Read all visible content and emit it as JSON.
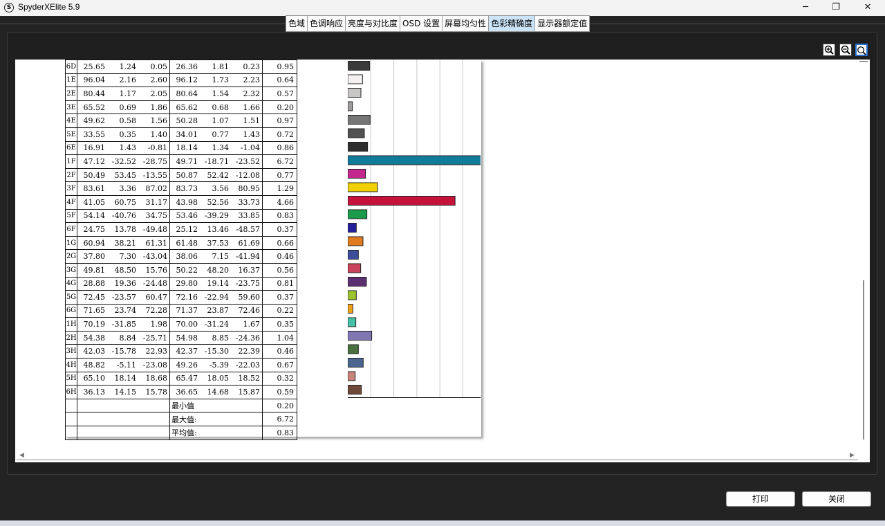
{
  "window": {
    "title": "SpyderXElite 5.9",
    "app_icon_glyph": "S",
    "controls": {
      "minimize": "─",
      "maximize": "❐",
      "close": "✕"
    }
  },
  "tabs": [
    {
      "label": "色域",
      "active": false
    },
    {
      "label": "色调响应",
      "active": false
    },
    {
      "label": "亮度与对比度",
      "active": false
    },
    {
      "label": "OSD 设置",
      "active": false
    },
    {
      "label": "屏幕均匀性",
      "active": false
    },
    {
      "label": "色彩精确度",
      "active": true
    },
    {
      "label": "显示器额定值",
      "active": false
    }
  ],
  "toolbar": {
    "icons": [
      "zoom-in-icon",
      "zoom-out-icon",
      "zoom-fit-icon"
    ]
  },
  "rows": [
    {
      "id": "6D",
      "ref": [
        "25.65",
        "1.24",
        "0.05"
      ],
      "meas": [
        "26.36",
        "1.81",
        "0.23"
      ],
      "de": "0.95",
      "color": "#3a3a3a"
    },
    {
      "id": "1E",
      "ref": [
        "96.04",
        "2.16",
        "2.60"
      ],
      "meas": [
        "96.12",
        "1.73",
        "2.23"
      ],
      "de": "0.64",
      "color": "#f4f0f0"
    },
    {
      "id": "2E",
      "ref": [
        "80.44",
        "1.17",
        "2.05"
      ],
      "meas": [
        "80.64",
        "1.54",
        "2.32"
      ],
      "de": "0.57",
      "color": "#c9c6c6"
    },
    {
      "id": "3E",
      "ref": [
        "65.52",
        "0.69",
        "1.86"
      ],
      "meas": [
        "65.62",
        "0.68",
        "1.66"
      ],
      "de": "0.20",
      "color": "#9e9c9c"
    },
    {
      "id": "4E",
      "ref": [
        "49.62",
        "0.58",
        "1.56"
      ],
      "meas": [
        "50.28",
        "1.07",
        "1.51"
      ],
      "de": "0.97",
      "color": "#767676"
    },
    {
      "id": "5E",
      "ref": [
        "33.55",
        "0.35",
        "1.40"
      ],
      "meas": [
        "34.01",
        "0.77",
        "1.43"
      ],
      "de": "0.72",
      "color": "#515151"
    },
    {
      "id": "6E",
      "ref": [
        "16.91",
        "1.43",
        "-0.81"
      ],
      "meas": [
        "18.14",
        "1.34",
        "-1.04"
      ],
      "de": "0.86",
      "color": "#2e2e2e"
    },
    {
      "id": "1F",
      "ref": [
        "47.12",
        "-32.52",
        "-28.75"
      ],
      "meas": [
        "49.71",
        "-18.71",
        "-23.52"
      ],
      "de": "6.72",
      "color": "#0f7d9a"
    },
    {
      "id": "2F",
      "ref": [
        "50.49",
        "53.45",
        "-13.55"
      ],
      "meas": [
        "50.87",
        "52.42",
        "-12.08"
      ],
      "de": "0.77",
      "color": "#c3278e"
    },
    {
      "id": "3F",
      "ref": [
        "83.61",
        "3.36",
        "87.02"
      ],
      "meas": [
        "83.73",
        "3.56",
        "80.95"
      ],
      "de": "1.29",
      "color": "#f1d000"
    },
    {
      "id": "4F",
      "ref": [
        "41.05",
        "60.75",
        "31.17"
      ],
      "meas": [
        "43.98",
        "52.56",
        "33.73"
      ],
      "de": "4.66",
      "color": "#c4123a"
    },
    {
      "id": "5F",
      "ref": [
        "54.14",
        "-40.76",
        "34.75"
      ],
      "meas": [
        "53.46",
        "-39.29",
        "33.85"
      ],
      "de": "0.83",
      "color": "#1a9a4a"
    },
    {
      "id": "6F",
      "ref": [
        "24.75",
        "13.78",
        "-49.48"
      ],
      "meas": [
        "25.12",
        "13.46",
        "-48.57"
      ],
      "de": "0.37",
      "color": "#25209a"
    },
    {
      "id": "1G",
      "ref": [
        "60.94",
        "38.21",
        "61.31"
      ],
      "meas": [
        "61.48",
        "37.53",
        "61.69"
      ],
      "de": "0.66",
      "color": "#e07a1e"
    },
    {
      "id": "2G",
      "ref": [
        "37.80",
        "7.30",
        "-43.04"
      ],
      "meas": [
        "38.06",
        "7.15",
        "-41.94"
      ],
      "de": "0.46",
      "color": "#3b4d9b"
    },
    {
      "id": "3G",
      "ref": [
        "49.81",
        "48.50",
        "15.76"
      ],
      "meas": [
        "50.22",
        "48.20",
        "16.37"
      ],
      "de": "0.56",
      "color": "#c9445a"
    },
    {
      "id": "4G",
      "ref": [
        "28.88",
        "19.36",
        "-24.48"
      ],
      "meas": [
        "29.80",
        "19.14",
        "-23.75"
      ],
      "de": "0.81",
      "color": "#5c2f71"
    },
    {
      "id": "5G",
      "ref": [
        "72.45",
        "-23.57",
        "60.47"
      ],
      "meas": [
        "72.16",
        "-22.94",
        "59.60"
      ],
      "de": "0.37",
      "color": "#9bc42f"
    },
    {
      "id": "6G",
      "ref": [
        "71.65",
        "23.74",
        "72.28"
      ],
      "meas": [
        "71.37",
        "23.87",
        "72.46"
      ],
      "de": "0.22",
      "color": "#eca21a"
    },
    {
      "id": "1H",
      "ref": [
        "70.19",
        "-31.85",
        "1.98"
      ],
      "meas": [
        "70.00",
        "-31.24",
        "1.67"
      ],
      "de": "0.35",
      "color": "#47c1a6"
    },
    {
      "id": "2H",
      "ref": [
        "54.38",
        "8.84",
        "-25.71"
      ],
      "meas": [
        "54.98",
        "8.85",
        "-24.36"
      ],
      "de": "1.04",
      "color": "#7f76b2"
    },
    {
      "id": "3H",
      "ref": [
        "42.03",
        "-15.78",
        "22.93"
      ],
      "meas": [
        "42.37",
        "-15.30",
        "22.39"
      ],
      "de": "0.46",
      "color": "#4b7141"
    },
    {
      "id": "4H",
      "ref": [
        "48.82",
        "-5.11",
        "-23.08"
      ],
      "meas": [
        "49.26",
        "-5.39",
        "-22.03"
      ],
      "de": "0.67",
      "color": "#4a6690"
    },
    {
      "id": "5H",
      "ref": [
        "65.10",
        "18.14",
        "18.68"
      ],
      "meas": [
        "65.47",
        "18.05",
        "18.52"
      ],
      "de": "0.32",
      "color": "#c8847a"
    },
    {
      "id": "6H",
      "ref": [
        "36.13",
        "14.15",
        "15.78"
      ],
      "meas": [
        "36.65",
        "14.68",
        "15.87"
      ],
      "de": "0.59",
      "color": "#6e4838"
    }
  ],
  "summary": [
    {
      "label": "最小值",
      "value": "0.20"
    },
    {
      "label": "最大值:",
      "value": "6.72"
    },
    {
      "label": "平均值:",
      "value": "0.83"
    }
  ],
  "chart_data": {
    "type": "bar",
    "orientation": "horizontal",
    "categories": [
      "6D",
      "1E",
      "2E",
      "3E",
      "4E",
      "5E",
      "6E",
      "1F",
      "2F",
      "3F",
      "4F",
      "5F",
      "6F",
      "1G",
      "2G",
      "3G",
      "4G",
      "5G",
      "6G",
      "1H",
      "2H",
      "3H",
      "4H",
      "5H",
      "6H"
    ],
    "values": [
      0.95,
      0.64,
      0.57,
      0.2,
      0.97,
      0.72,
      0.86,
      6.72,
      0.77,
      1.29,
      4.66,
      0.83,
      0.37,
      0.66,
      0.46,
      0.56,
      0.81,
      0.37,
      0.22,
      0.35,
      1.04,
      0.46,
      0.67,
      0.32,
      0.59
    ],
    "xlim": [
      0,
      8
    ],
    "grid": true
  },
  "buttons": {
    "print": "打印",
    "close": "关闭"
  }
}
